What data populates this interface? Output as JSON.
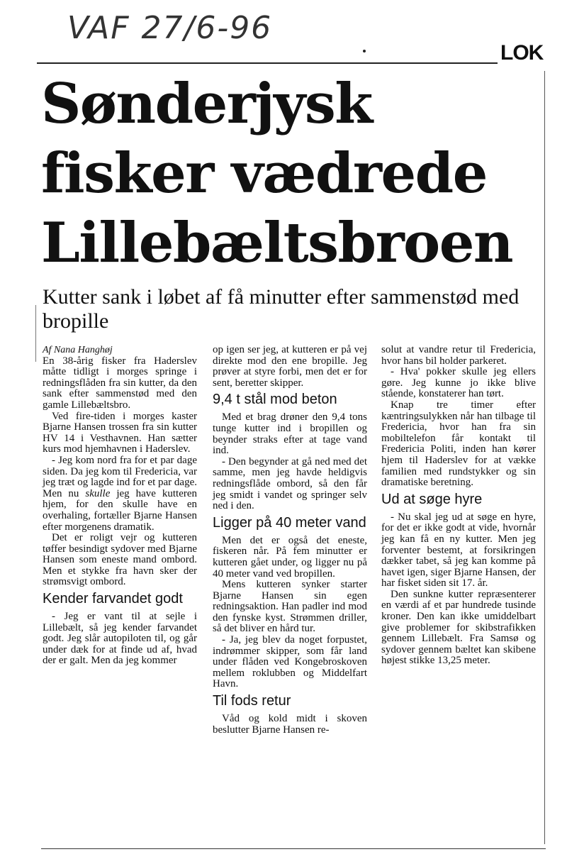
{
  "stamp": "VAF  27/6-96",
  "section": "LOK",
  "headline": [
    "Sønderjysk",
    "fisker vædrede",
    "Lillebæltsbroen"
  ],
  "subhead": "Kutter sank i løbet af få minutter efter sammenstød med bropille",
  "byline": "Af Nana Hanghøj",
  "col1": {
    "p1": "En 38-årig fisker fra Haderslev måtte tidligt i morges springe i redningsflåden fra sin kutter, da den sank efter sammenstød med den gamle Lillebæltsbro.",
    "p2": "Ved fire-tiden i morges kaster Bjarne Hansen trossen fra sin kutter HV 14 i Vesthavnen. Han sætter kurs mod hjemhavnen i Haderslev.",
    "p3a": "- Jeg kom nord fra for et par dage siden. Da jeg kom til Fredericia, var jeg træt og lagde ind for et par dage. Men nu ",
    "p3em": "skulle",
    "p3b": " jeg have kutteren hjem, for den skulle have en overhaling, fortæller Bjarne Hansen efter morgenens dramatik.",
    "p4": "Det er roligt vejr og kutteren tøffer besindigt sydover med Bjarne Hansen som eneste mand ombord. Men et stykke fra havn sker der strømsvigt ombord.",
    "h1": "Kender farvandet godt",
    "p5": "- Jeg er vant til at sejle i Lillebælt, så jeg kender farvandet godt. Jeg slår autopiloten til, og går under dæk for at finde ud af, hvad der er galt. Men da jeg kommer"
  },
  "col2": {
    "p1": "op igen ser jeg, at kutteren er på vej direkte mod den ene bropille. Jeg prøver at styre forbi, men det er for sent, beretter skipper.",
    "h1": "9,4 t stål mod beton",
    "p2": "Med et brag drøner den 9,4 tons tunge kutter ind i bropillen og beynder straks efter at tage vand ind.",
    "p3": "- Den begynder at gå ned med det samme, men jeg havde heldigvis redningsflåde ombord, så den får jeg smidt i vandet og springer selv ned i den.",
    "h2": "Ligger på 40 meter vand",
    "p4": "Men det er også det eneste, fiskeren når. På fem minutter er kutteren gået under, og ligger nu på 40 meter vand ved bropillen.",
    "p5": "Mens kutteren synker starter Bjarne Hansen sin egen redningsaktion. Han padler ind mod den fynske kyst. Strømmen driller, så det bliver en hård tur.",
    "p6": "- Ja, jeg blev da noget forpustet, indrømmer skipper, som får land under flåden ved Kongebroskoven mellem roklubben og Middelfart Havn.",
    "h3": "Til fods retur",
    "p7": "Våd og kold midt i skoven beslutter Bjarne Hansen re-"
  },
  "col3": {
    "p1": "solut at vandre retur til Fredericia, hvor hans bil holder parkeret.",
    "p2": "- Hva' pokker skulle jeg ellers gøre. Jeg kunne jo ikke blive stående, konstaterer han tørt.",
    "p3": "Knap tre timer efter kæntringsulykken når han tilbage til Fredericia, hvor han fra sin mobiltelefon får kontakt til Fredericia Politi, inden han kører hjem til Haderslev for at vække familien med rundstykker og sin dramatiske beretning.",
    "h1": "Ud at søge hyre",
    "p4": "- Nu skal jeg ud at søge en hyre, for det er ikke godt at vide, hvornår jeg kan få en ny kutter. Men jeg forventer bestemt, at forsikringen dækker tabet, så jeg kan komme på havet igen, siger Bjarne Hansen, der har fisket siden sit 17. år.",
    "p5": "Den sunkne kutter repræsenterer en værdi af et par hundrede tusinde kroner. Den kan ikke umiddelbart give problemer for skibstrafikken gennem Lillebælt. Fra Samsø og sydover gennem bæltet kan skibene højest stikke 13,25 meter."
  }
}
